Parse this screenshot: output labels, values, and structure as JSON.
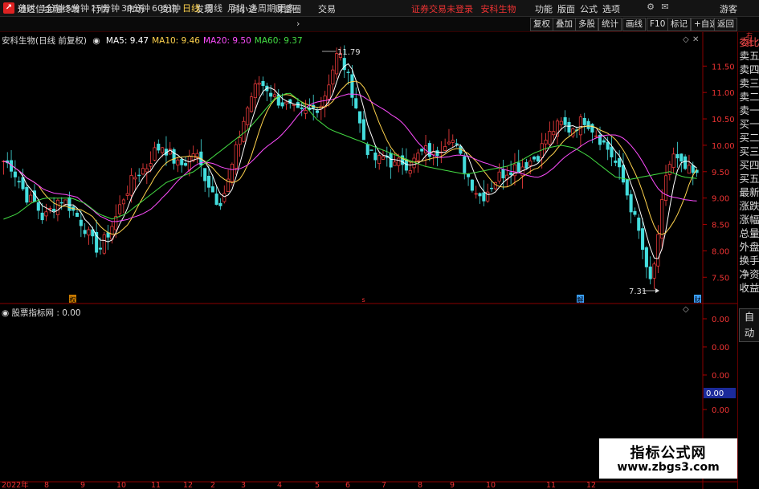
{
  "app": {
    "title": "通达信金融终端",
    "menu": [
      "行情",
      "市场",
      "资讯",
      "发现",
      "问小达",
      "财富圈",
      "交易"
    ],
    "notice": "证券交易未登录",
    "stock_link": "安科生物",
    "right_menu": [
      "功能",
      "版面",
      "公式",
      "选项"
    ],
    "guest": "游客"
  },
  "toolbar": {
    "periods": [
      "分时",
      "1分钟",
      "5分钟",
      "15分钟",
      "30分钟",
      "60分钟",
      "日线",
      "周线",
      "月线",
      "多周期",
      "更多"
    ],
    "active_period": "日线",
    "buttons": [
      "复权",
      "叠加",
      "多股",
      "统计",
      "画线",
      "F10",
      "标记",
      "+自选",
      "返回"
    ]
  },
  "main_header": {
    "stock": "安科生物(日线 前复权)",
    "ma": [
      {
        "label": "MA5: 9.47",
        "color": "#ffffff"
      },
      {
        "label": "MA10: 9.46",
        "color": "#ffd34d"
      },
      {
        "label": "MA20: 9.50",
        "color": "#ff4dff"
      },
      {
        "label": "MA60: 9.37",
        "color": "#44dd44"
      }
    ]
  },
  "annotations": {
    "high": "11.79",
    "low": "7.31"
  },
  "price_axis": [
    "11.50",
    "11.00",
    "10.50",
    "10.00",
    "9.50",
    "9.00",
    "8.50",
    "8.00",
    "7.50"
  ],
  "date_axis": [
    "2022年",
    "8",
    "9",
    "10",
    "11",
    "12",
    "2",
    "3",
    "4",
    "5",
    "6",
    "7",
    "8",
    "9",
    "10",
    "11",
    "12"
  ],
  "event_markers": [
    "权",
    "s",
    "解",
    "财"
  ],
  "sub_indicator": {
    "name": "股票指标网",
    "value": ": 0.00",
    "current": "0.00",
    "ticks": [
      "0.00",
      "0.00",
      "0.00",
      "0.00",
      "0.00"
    ]
  },
  "side_panel": {
    "red_label": "委比",
    "items": [
      "委比",
      "卖五",
      "卖四",
      "卖三",
      "卖二",
      "卖一",
      "买一",
      "买二",
      "买三",
      "买四",
      "买五",
      "最新",
      "涨跌",
      "涨幅",
      "总量",
      "外盘",
      "换手",
      "净资",
      "收益"
    ],
    "auto": "自动"
  },
  "colors": {
    "up": "#ff4040",
    "down": "#44dddd",
    "axis": "#7a0000",
    "ma5": "#ffffff",
    "ma10": "#ffd34d",
    "ma20": "#ff4dff",
    "ma60": "#44dd44"
  },
  "watermark": {
    "title": "指标公式网",
    "url": "www.zbgs3.com"
  },
  "chart_data": {
    "type": "candlestick",
    "ylim": [
      7.2,
      11.9
    ],
    "close_path": [
      9.7,
      9.6,
      9.3,
      9.0,
      8.9,
      8.6,
      8.8,
      9.0,
      8.9,
      8.7,
      8.5,
      8.2,
      8.0,
      8.3,
      8.6,
      9.0,
      9.3,
      9.5,
      9.6,
      9.9,
      10.0,
      9.8,
      9.6,
      9.7,
      9.9,
      9.5,
      9.2,
      8.9,
      9.2,
      9.8,
      10.4,
      10.9,
      11.2,
      11.1,
      10.9,
      10.8,
      10.7,
      10.6,
      10.6,
      10.7,
      10.8,
      11.3,
      11.79,
      11.4,
      10.9,
      10.2,
      9.8,
      9.7,
      9.8,
      9.6,
      9.7,
      9.6,
      9.8,
      9.9,
      9.8,
      10.0,
      10.2,
      9.9,
      9.5,
      9.2,
      9.0,
      9.2,
      9.4,
      9.5,
      9.6,
      9.6,
      9.7,
      9.8,
      10.1,
      10.3,
      10.4,
      10.3,
      10.4,
      10.5,
      10.3,
      10.1,
      9.9,
      9.6,
      9.2,
      8.7,
      8.2,
      7.31,
      8.0,
      9.4,
      9.8,
      9.6,
      9.5,
      9.4
    ],
    "ma60_path": [
      8.6,
      8.7,
      8.9,
      9.0,
      9.0,
      9.0,
      8.9,
      8.7,
      8.6,
      8.7,
      8.9,
      9.1,
      9.3,
      9.4,
      9.5,
      9.7,
      9.9,
      10.1,
      10.3,
      10.6,
      10.9,
      11.0,
      10.8,
      10.5,
      10.3,
      10.2,
      10.1,
      10.0,
      9.9,
      9.8,
      9.7,
      9.6,
      9.55,
      9.5,
      9.45,
      9.5,
      9.55,
      9.6,
      9.7,
      9.85,
      9.95,
      10.0,
      9.95,
      9.8,
      9.6,
      9.4,
      9.35,
      9.4,
      9.45,
      9.5,
      9.4,
      9.37
    ]
  }
}
